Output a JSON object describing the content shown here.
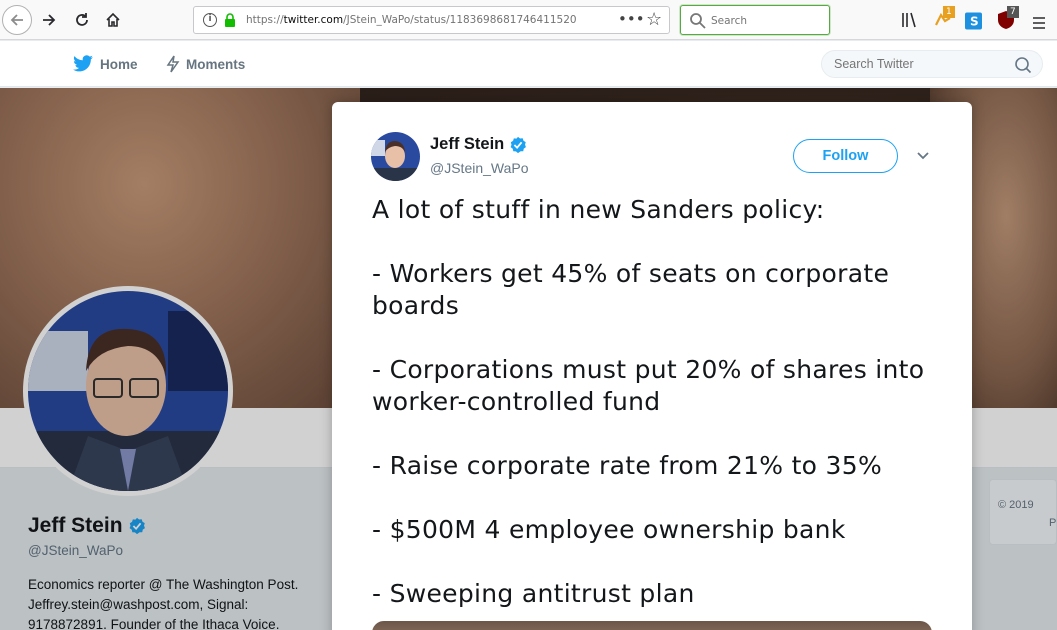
{
  "browser": {
    "url_prefix": "https://",
    "url_host": "twitter.com",
    "url_path": "/JStein_WaPo/status/1183698681746411520",
    "search_placeholder": "Search",
    "badge_count_1": "1",
    "badge_count_2": "7"
  },
  "nav": {
    "home_label": "Home",
    "moments_label": "Moments",
    "search_placeholder": "Search Twitter"
  },
  "profile": {
    "name": "Jeff Stein",
    "handle": "@JStein_WaPo",
    "bio": "Economics reporter @ The Washington Post. Jeffrey.stein@washpost.com, Signal: 9178872891. Founder of the Ithaca Voice.",
    "footer_line1": "© 2019",
    "footer_line2": "P"
  },
  "tweet": {
    "author_name": "Jeff Stein",
    "author_handle": "@JStein_WaPo",
    "follow_label": "Follow",
    "lines": [
      "A lot of stuff in new Sanders policy:",
      "",
      "- Workers get 45% of seats on corporate boards",
      "",
      "- Corporations must put 20% of shares into worker-controlled fund",
      "",
      "- Raise corporate rate from 21% to 35%",
      "",
      "- $500M 4 employee ownership bank",
      "",
      "- Sweeping antitrust plan"
    ]
  },
  "colors": {
    "twitter_blue": "#1da1f2",
    "text_primary": "#14171a",
    "text_secondary": "#657786"
  }
}
